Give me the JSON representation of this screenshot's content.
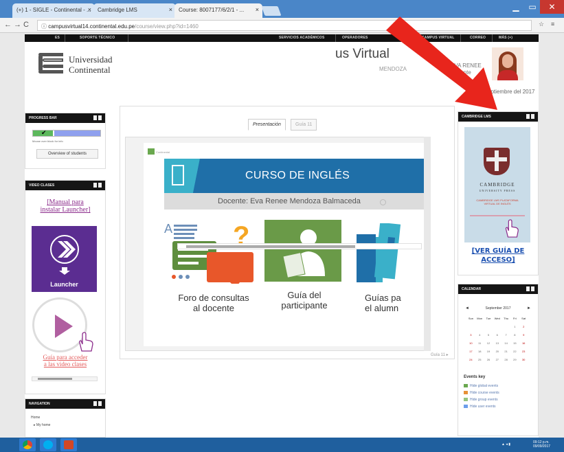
{
  "browser": {
    "tabs": [
      {
        "label": "(+) 1 - SIGLE - Continental - ...",
        "close": "×"
      },
      {
        "label": "Cambridge LMS",
        "close": "×"
      },
      {
        "label": "Course: 8007177/6/2/1 - ...",
        "close": "×"
      }
    ],
    "window_controls": [
      "▁",
      "▭",
      "✕"
    ],
    "nav": {
      "back": "←",
      "forward": "→",
      "reload": "C",
      "info": "ⓘ"
    },
    "url_host": "campusvirtual14.continental.edu.pe",
    "url_path": "/course/view.php?id=1460",
    "right_icons": [
      "☆",
      "≡"
    ]
  },
  "topnav": {
    "items": [
      "ES",
      "SOPORTE TÉCNICO",
      "SERVICIOS ACADÉMICOS",
      "OPERADORES",
      "CAMPUS VIRTUAL",
      "CORREO",
      "MÁS (+)"
    ]
  },
  "header": {
    "brand_line1": "Universidad",
    "brand_line2": "Continental",
    "campus_title": "us Virtual",
    "user_name": "EVA RENEE",
    "user_sub": "Docente",
    "user_inline": "MENDOZA",
    "date": "septiembre del 2017"
  },
  "blocks": {
    "progress": {
      "title": "PROGRESS BAR",
      "progress_fraction": 0.3,
      "tick": "✔",
      "caption": "Mouse over block for info",
      "button": "Overview of students"
    },
    "video": {
      "title": "VIDEO CLASES",
      "manual_line1": "[Manual para",
      "manual_line2": "instalar Launcher]",
      "launcher_label": "Launcher",
      "guia_line1": "Guía para acceder",
      "guia_line2": "a las video clases"
    },
    "navigation": {
      "title": "NAVIGATION",
      "home": "Home",
      "my_home": "My home"
    },
    "cambridge": {
      "title": "CAMBRIDGE LMS",
      "logo_text": "CAMBRIDGE",
      "logo_sub": "UNIVERSITY PRESS",
      "small_text": "CAMBRIDGE LMS PLATAFORMA VIRTUAL DE INGLÉS",
      "link_line1": "[VER GUÍA DE",
      "link_line2": "ACCESO]"
    },
    "calendar": {
      "title": "CALENDAR",
      "month": "September 2017",
      "prev": "◄",
      "next": "►",
      "days": [
        "Sun",
        "Mon",
        "Tue",
        "Wed",
        "Thu",
        "Fri",
        "Sat"
      ],
      "weeks": [
        [
          "",
          "",
          "",
          "",
          "",
          "1",
          "2"
        ],
        [
          "3",
          "4",
          "5",
          "6",
          "7",
          "8",
          "9"
        ],
        [
          "10",
          "11",
          "12",
          "13",
          "14",
          "15",
          "16"
        ],
        [
          "17",
          "18",
          "19",
          "20",
          "21",
          "22",
          "23"
        ],
        [
          "24",
          "25",
          "26",
          "27",
          "28",
          "29",
          "30"
        ]
      ],
      "events_key": "Events key",
      "events": [
        {
          "label": "Hide global events",
          "color": "#6aa84f"
        },
        {
          "label": "Hide course events",
          "color": "#e69138"
        },
        {
          "label": "Hide group events",
          "color": "#93c47d"
        },
        {
          "label": "Hide user events",
          "color": "#6d9eeb"
        }
      ]
    }
  },
  "main": {
    "tabs": [
      "Presentación",
      "Guía 11"
    ],
    "next_link": "Guía 11 ▸",
    "slide": {
      "brand": "Continental",
      "banner_title": "CURSO DE INGLÉS",
      "docente": "Docente: Eva Renee Mendoza Balmaceda",
      "foro_line1": "Foro de consultas",
      "foro_line2": "al docente",
      "guia_line1": "Guía del",
      "guia_line2": "participante",
      "guias_line1": "Guías pa",
      "guias_line2": "el alumn"
    }
  },
  "taskbar": {
    "time": "09:12 p.m.",
    "date": "09/09/2017",
    "tray": "▲ ◂ ▮"
  },
  "colors": {
    "arrow": "#e8251c",
    "launcher": "#5b2d91",
    "banner": "#1f6fa8"
  }
}
